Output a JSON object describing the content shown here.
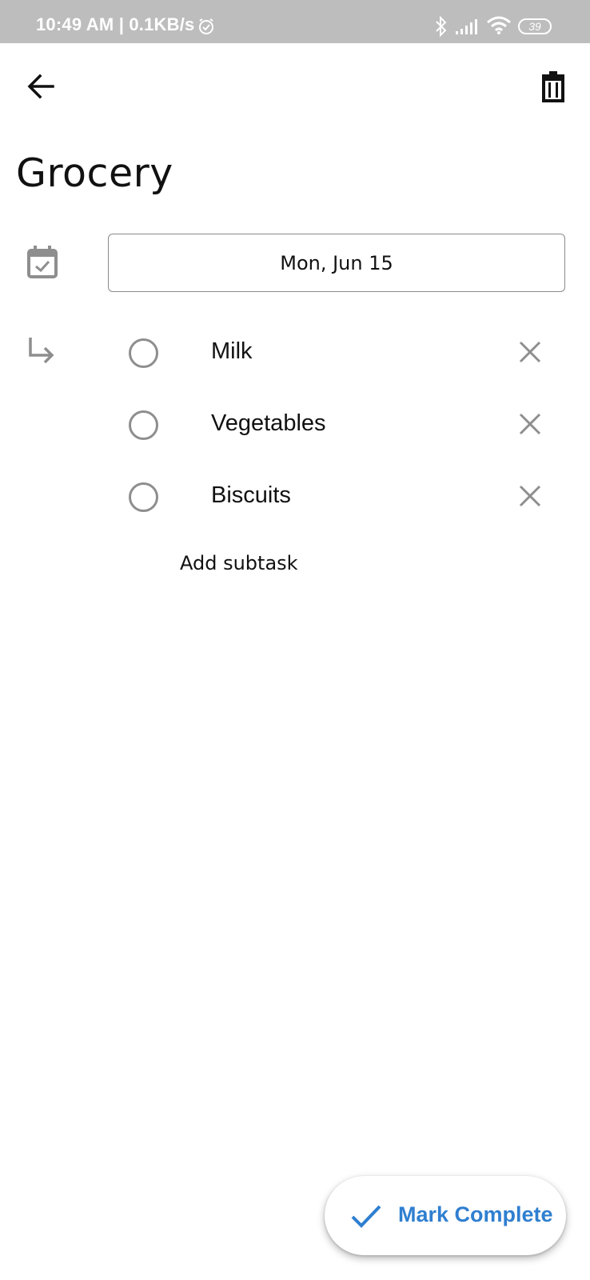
{
  "status_bar": {
    "text": "10:49 AM | 0.1KB/s",
    "battery": "39",
    "icons": [
      "alarm-icon",
      "bluetooth-icon",
      "signal-icon",
      "wifi-icon",
      "battery-icon"
    ]
  },
  "toolbar": {
    "back_icon": "arrow-left-icon",
    "delete_icon": "trash-icon"
  },
  "task": {
    "title": "Grocery",
    "date": "Mon, Jun 15"
  },
  "subtasks": [
    {
      "label": "Milk",
      "done": false
    },
    {
      "label": "Vegetables",
      "done": false
    },
    {
      "label": "Biscuits",
      "done": false
    }
  ],
  "add_subtask_label": "Add subtask",
  "fab": {
    "label": "Mark Complete",
    "icon": "check-icon",
    "color": "#2f7fd0"
  },
  "colors": {
    "status_bar": "#bdbdbd",
    "icon_gray": "#8e8e8e",
    "accent": "#2f7fd0"
  }
}
